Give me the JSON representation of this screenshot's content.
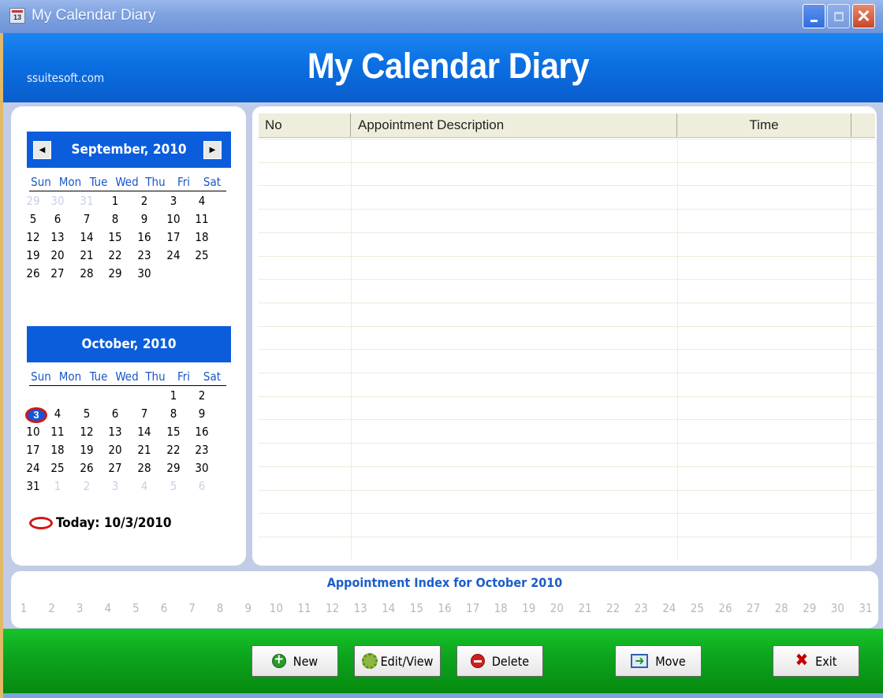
{
  "window": {
    "title": "My Calendar Diary",
    "app_icon_text": "13",
    "controls": {
      "minimize": "minimize-icon",
      "maximize": "maximize-icon",
      "close": "close-icon"
    }
  },
  "header": {
    "site": "ssuitesoft.com",
    "title": "My Calendar Diary"
  },
  "calendar": {
    "days_of_week": [
      "Sun",
      "Mon",
      "Tue",
      "Wed",
      "Thu",
      "Fri",
      "Sat"
    ],
    "months": [
      {
        "title": "September, 2010",
        "show_nav": true,
        "weeks": [
          [
            {
              "d": "29",
              "o": true
            },
            {
              "d": "30",
              "o": true
            },
            {
              "d": "31",
              "o": true
            },
            {
              "d": "1"
            },
            {
              "d": "2"
            },
            {
              "d": "3"
            },
            {
              "d": "4"
            }
          ],
          [
            {
              "d": "5"
            },
            {
              "d": "6"
            },
            {
              "d": "7"
            },
            {
              "d": "8"
            },
            {
              "d": "9"
            },
            {
              "d": "10"
            },
            {
              "d": "11"
            }
          ],
          [
            {
              "d": "12"
            },
            {
              "d": "13"
            },
            {
              "d": "14"
            },
            {
              "d": "15"
            },
            {
              "d": "16"
            },
            {
              "d": "17"
            },
            {
              "d": "18"
            }
          ],
          [
            {
              "d": "19"
            },
            {
              "d": "20"
            },
            {
              "d": "21"
            },
            {
              "d": "22"
            },
            {
              "d": "23"
            },
            {
              "d": "24"
            },
            {
              "d": "25"
            }
          ],
          [
            {
              "d": "26"
            },
            {
              "d": "27"
            },
            {
              "d": "28"
            },
            {
              "d": "29"
            },
            {
              "d": "30"
            },
            {
              "d": ""
            },
            {
              "d": ""
            }
          ]
        ]
      },
      {
        "title": "October, 2010",
        "show_nav": false,
        "weeks": [
          [
            {
              "d": ""
            },
            {
              "d": ""
            },
            {
              "d": ""
            },
            {
              "d": ""
            },
            {
              "d": ""
            },
            {
              "d": "1"
            },
            {
              "d": "2"
            }
          ],
          [
            {
              "d": "3",
              "today": true
            },
            {
              "d": "4"
            },
            {
              "d": "5"
            },
            {
              "d": "6"
            },
            {
              "d": "7"
            },
            {
              "d": "8"
            },
            {
              "d": "9"
            }
          ],
          [
            {
              "d": "10"
            },
            {
              "d": "11"
            },
            {
              "d": "12"
            },
            {
              "d": "13"
            },
            {
              "d": "14"
            },
            {
              "d": "15"
            },
            {
              "d": "16"
            }
          ],
          [
            {
              "d": "17"
            },
            {
              "d": "18"
            },
            {
              "d": "19"
            },
            {
              "d": "20"
            },
            {
              "d": "21"
            },
            {
              "d": "22"
            },
            {
              "d": "23"
            }
          ],
          [
            {
              "d": "24"
            },
            {
              "d": "25"
            },
            {
              "d": "26"
            },
            {
              "d": "27"
            },
            {
              "d": "28"
            },
            {
              "d": "29"
            },
            {
              "d": "30"
            }
          ],
          [
            {
              "d": "31"
            },
            {
              "d": "1",
              "o": true
            },
            {
              "d": "2",
              "o": true
            },
            {
              "d": "3",
              "o": true
            },
            {
              "d": "4",
              "o": true
            },
            {
              "d": "5",
              "o": true
            },
            {
              "d": "6",
              "o": true
            }
          ]
        ]
      }
    ],
    "today_label": "Today: 10/3/2010",
    "nav": {
      "prev": "◀",
      "next": "▶"
    }
  },
  "appointments": {
    "columns": [
      "No",
      "Appointment Description",
      "Time"
    ],
    "rows": []
  },
  "index": {
    "title": "Appointment Index for October 2010",
    "days": [
      "1",
      "2",
      "3",
      "4",
      "5",
      "6",
      "7",
      "8",
      "9",
      "10",
      "11",
      "12",
      "13",
      "14",
      "15",
      "16",
      "17",
      "18",
      "19",
      "20",
      "21",
      "22",
      "23",
      "24",
      "25",
      "26",
      "27",
      "28",
      "29",
      "30",
      "31"
    ]
  },
  "toolbar": {
    "new": "New",
    "edit": "Edit/View",
    "delete": "Delete",
    "move": "Move",
    "exit": "Exit"
  },
  "colors": {
    "header_blue": "#0b6fe2",
    "month_blue": "#0b5ddc",
    "toolbar_green": "#0ea61e",
    "today_red": "#d21717",
    "index_title_blue": "#1c5dc9"
  }
}
